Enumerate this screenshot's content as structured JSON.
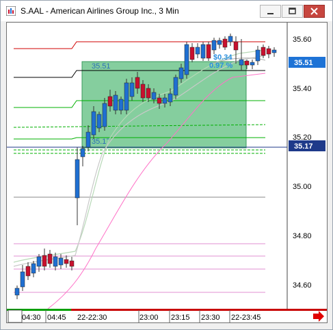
{
  "window": {
    "title": "S.AAL - American Airlines Group Inc., 3 Min"
  },
  "price_axis": {
    "ticks": [
      "35.60",
      "35.40",
      "35.20",
      "35.00",
      "34.80",
      "34.60"
    ],
    "current_price_label": "35.51",
    "crosshair_price_label": "35.17"
  },
  "time_axis": {
    "ticks": [
      "04:30",
      "04:45",
      "22-22:30",
      "23:00",
      "23:15",
      "23:30",
      "22-23:45"
    ]
  },
  "measure_box": {
    "top_price": "35.51",
    "bottom_price": "35.17",
    "change": "$0.34",
    "change_pct": "0.97 %"
  },
  "colors": {
    "up_candle": "#1f6fd1",
    "down_candle": "#c8102e",
    "measure_fill": "#5cbd7e",
    "current_price_tag": "#1e73d6",
    "crosshair_tag": "#1e3a8a"
  },
  "icons": {
    "next_arrow": "red-right-arrow-icon",
    "window_min": "minimize-icon",
    "window_restore": "restore-icon",
    "window_close": "close-icon"
  }
}
